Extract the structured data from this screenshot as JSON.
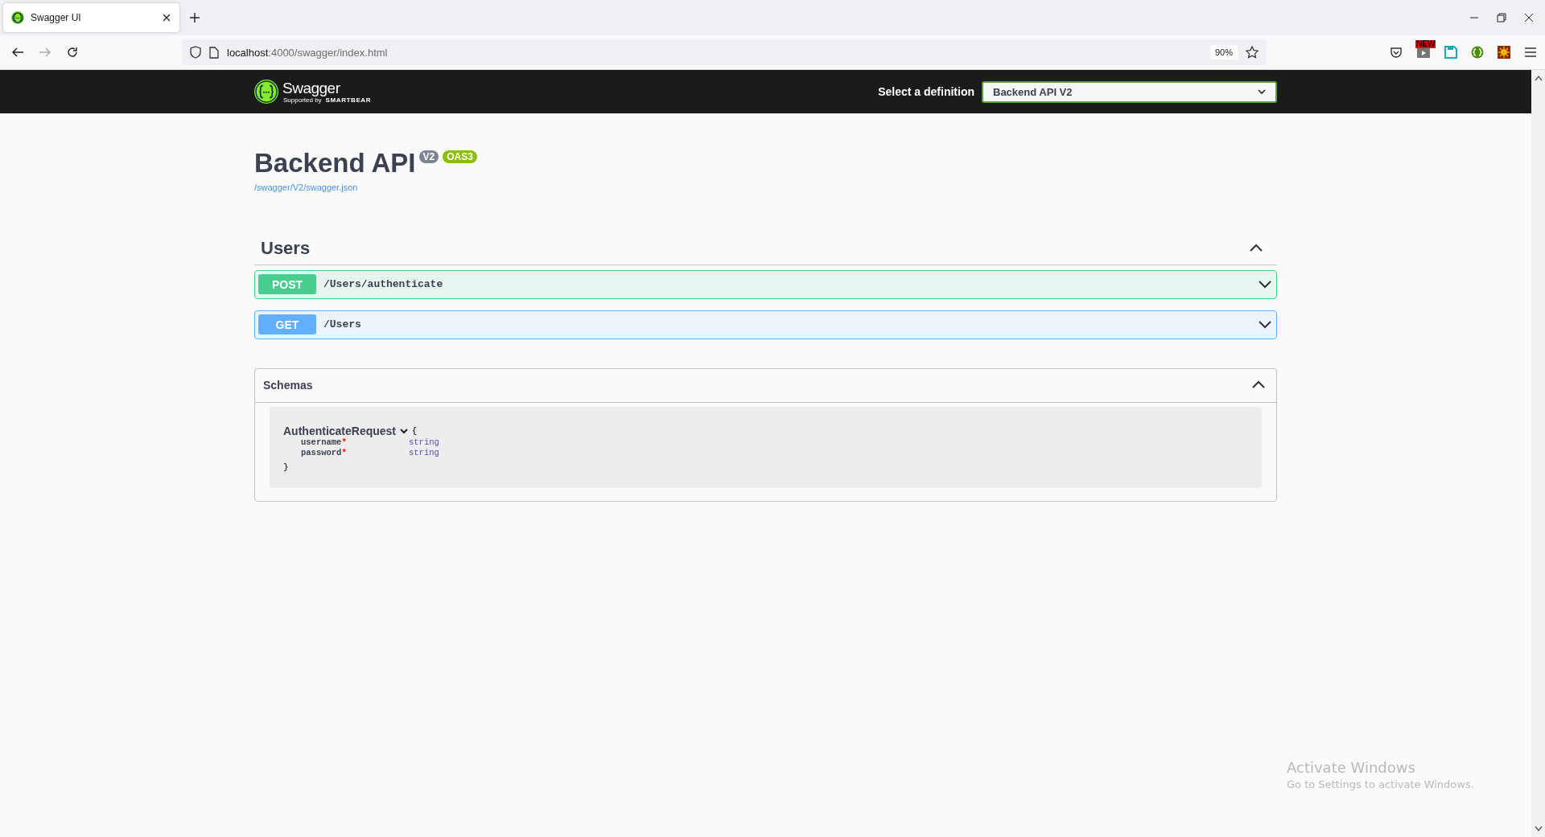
{
  "browser": {
    "tabs": [
      {
        "title": "Swagger UI",
        "selected": true
      }
    ],
    "url_host": "localhost",
    "url_rest": ":4000/swagger/index.html",
    "zoom": "90%",
    "extension_badge": "NEW"
  },
  "topbar": {
    "logo": "Swagger",
    "logo_sub": "Supported by",
    "logo_brand": "SMARTBEAR",
    "definition_label": "Select a definition",
    "definition_value": "Backend API V2"
  },
  "info": {
    "title": "Backend API",
    "version": "V2",
    "spec": "OAS3",
    "spec_url": "/swagger/V2/swagger.json"
  },
  "tags": [
    {
      "name": "Users",
      "expanded": true,
      "operations": [
        {
          "method": "POST",
          "path": "/Users/authenticate",
          "expanded": false
        },
        {
          "method": "GET",
          "path": "/Users",
          "expanded": false
        }
      ]
    }
  ],
  "schemas": {
    "title": "Schemas",
    "expanded": true,
    "required_mark": "*",
    "models": [
      {
        "name": "AuthenticateRequest",
        "expanded": true,
        "open_brace": "{",
        "close_brace": "}",
        "properties": [
          {
            "name": "username",
            "required": true,
            "type": "string"
          },
          {
            "name": "password",
            "required": true,
            "type": "string"
          }
        ]
      }
    ]
  },
  "os_notice": {
    "title": "Activate Windows",
    "text": "Go to Settings to activate Windows."
  }
}
